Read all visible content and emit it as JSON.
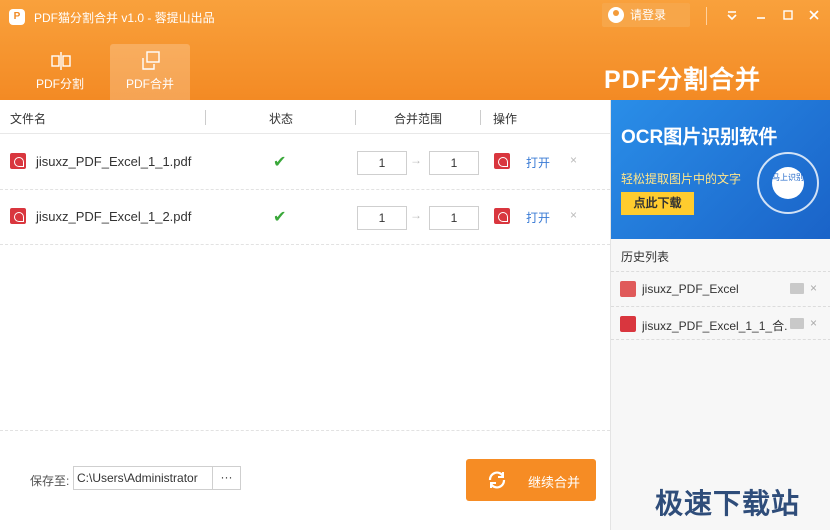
{
  "window": {
    "title": "PDF猫分割合并 v1.0 - 蓉提山出品",
    "login_label": "请登录"
  },
  "tabs": [
    {
      "label": "PDF分割",
      "icon": "split-icon"
    },
    {
      "label": "PDF合并",
      "icon": "merge-icon"
    }
  ],
  "brand_title": "PDF分割合并",
  "table": {
    "headers": {
      "filename": "文件名",
      "status": "状态",
      "range": "合并范围",
      "action": "操作"
    },
    "rows": [
      {
        "filename": "jisuxz_PDF_Excel_1_1.pdf",
        "status": "✔",
        "from": "1",
        "to": "1",
        "open": "打开",
        "delete": "×"
      },
      {
        "filename": "jisuxz_PDF_Excel_1_2.pdf",
        "status": "✔",
        "from": "1",
        "to": "1",
        "open": "打开",
        "delete": "×"
      }
    ]
  },
  "footer": {
    "save_label": "保存至:",
    "save_path": "C:\\Users\\Administrator",
    "browse_label": "···",
    "merge_label": "继续合并"
  },
  "ad": {
    "title": "OCR图片识别软件",
    "subtitle": "轻松提取图片中的文字",
    "button": "点此下载",
    "badge": "马上识别"
  },
  "history": {
    "title": "历史列表",
    "items": [
      {
        "label": "jisuxz_PDF_Excel",
        "icon": "image-file-icon"
      },
      {
        "label": "jisuxz_PDF_Excel_1_1_合...",
        "icon": "pdf-file-icon"
      }
    ]
  },
  "watermark": "极速下载站",
  "colors": {
    "header_orange": "#f38a24",
    "accent_blue": "#3a7bd5",
    "success_green": "#3aa83a",
    "pdf_red": "#d9363e"
  }
}
